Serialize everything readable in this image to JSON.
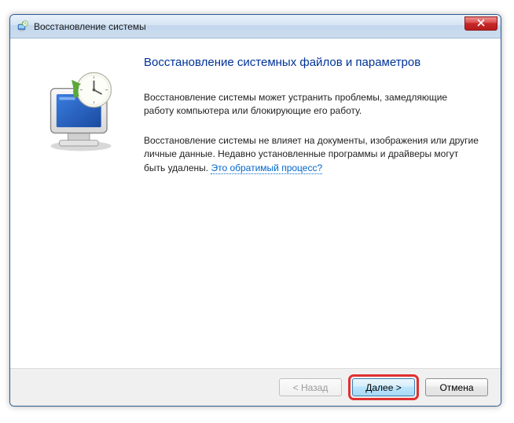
{
  "window": {
    "title": "Восстановление системы"
  },
  "content": {
    "heading": "Восстановление системных файлов и параметров",
    "para1": "Восстановление системы может устранить проблемы, замедляющие работу компьютера или блокирующие его работу.",
    "para2_part1": "Восстановление системы не влияет на документы, изображения или другие личные данные. Недавно установленные программы и драйверы могут быть удалены. ",
    "para2_link": "Это обратимый процесс?"
  },
  "buttons": {
    "back": "< Назад",
    "next": "Далее >",
    "cancel": "Отмена"
  }
}
